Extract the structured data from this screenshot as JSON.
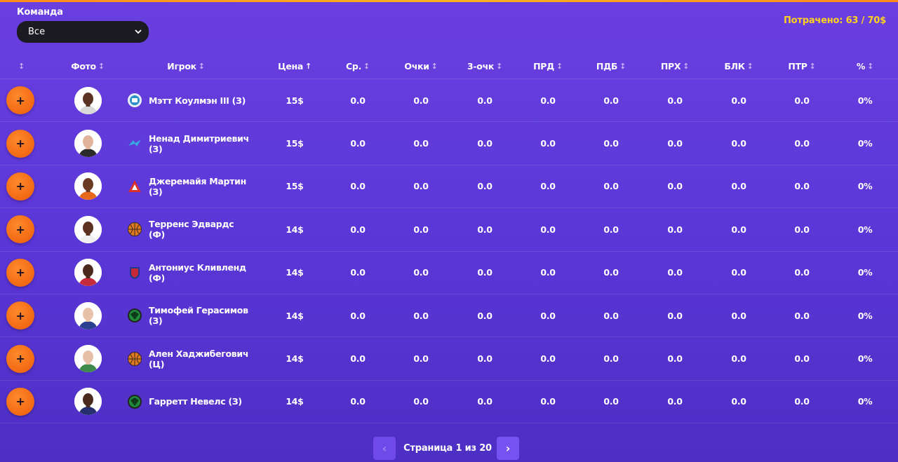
{
  "filter": {
    "label": "Команда",
    "selected": "Все"
  },
  "budget": {
    "text": "Потрачено: 63 / 70$"
  },
  "table": {
    "columns": [
      {
        "key": "add",
        "label": "",
        "sort": "↕"
      },
      {
        "key": "photo",
        "label": "Фото",
        "sort": "↕"
      },
      {
        "key": "player",
        "label": "Игрок",
        "sort": "↕"
      },
      {
        "key": "price",
        "label": "Цена",
        "sort": "↑"
      },
      {
        "key": "avg",
        "label": "Ср.",
        "sort": "↕"
      },
      {
        "key": "points",
        "label": "Очки",
        "sort": "↕"
      },
      {
        "key": "three",
        "label": "3-очк",
        "sort": "↕"
      },
      {
        "key": "ast",
        "label": "ПРД",
        "sort": "↕"
      },
      {
        "key": "reb",
        "label": "ПДБ",
        "sort": "↕"
      },
      {
        "key": "stl",
        "label": "ПРХ",
        "sort": "↕"
      },
      {
        "key": "blk",
        "label": "БЛК",
        "sort": "↕"
      },
      {
        "key": "tov",
        "label": "ПТР",
        "sort": "↕"
      },
      {
        "key": "pct",
        "label": "%",
        "sort": "↕"
      }
    ],
    "rows": [
      {
        "add": "+",
        "name": "Мэтт Коулмэн III (З)",
        "price": "15$",
        "avg": "0.0",
        "points": "0.0",
        "three": "0.0",
        "ast": "0.0",
        "reb": "0.0",
        "stl": "0.0",
        "blk": "0.0",
        "tov": "0.0",
        "pct": "0%",
        "team_logo": "parma-logo-icon",
        "team_color": "#2f8ec9",
        "skin": "#5a3324",
        "jersey": "#d9d9d9"
      },
      {
        "add": "+",
        "name": "Ненад Димитриевич (З)",
        "price": "15$",
        "avg": "0.0",
        "points": "0.0",
        "three": "0.0",
        "ast": "0.0",
        "reb": "0.0",
        "stl": "0.0",
        "blk": "0.0",
        "tov": "0.0",
        "pct": "0%",
        "team_logo": "zenit-logo-icon",
        "team_color": "#39a7e0",
        "skin": "#e0b49a",
        "jersey": "#2b2b2b"
      },
      {
        "add": "+",
        "name": "Джеремайя Мартин (З)",
        "price": "15$",
        "avg": "0.0",
        "points": "0.0",
        "three": "0.0",
        "ast": "0.0",
        "reb": "0.0",
        "stl": "0.0",
        "blk": "0.0",
        "tov": "0.0",
        "pct": "0%",
        "team_logo": "lokomotiv-logo-icon",
        "team_color": "#d9322a",
        "skin": "#6b3a22",
        "jersey": "#e76a1c"
      },
      {
        "add": "+",
        "name": "Терренс Эдвардс (Ф)",
        "price": "14$",
        "avg": "0.0",
        "points": "0.0",
        "three": "0.0",
        "ast": "0.0",
        "reb": "0.0",
        "stl": "0.0",
        "blk": "0.0",
        "tov": "0.0",
        "pct": "0%",
        "team_logo": "ball-logo-icon",
        "team_color": "#e07a22",
        "skin": "#5b3220",
        "jersey": "#f0f0f0"
      },
      {
        "add": "+",
        "name": "Антониус Кливленд (Ф)",
        "price": "14$",
        "avg": "0.0",
        "points": "0.0",
        "three": "0.0",
        "ast": "0.0",
        "reb": "0.0",
        "stl": "0.0",
        "blk": "0.0",
        "tov": "0.0",
        "pct": "0%",
        "team_logo": "cska-logo-icon",
        "team_color": "#c8283a",
        "skin": "#4b2a1c",
        "jersey": "#c52b3a"
      },
      {
        "add": "+",
        "name": "Тимофей Герасимов (З)",
        "price": "14$",
        "avg": "0.0",
        "points": "0.0",
        "three": "0.0",
        "ast": "0.0",
        "reb": "0.0",
        "stl": "0.0",
        "blk": "0.0",
        "tov": "0.0",
        "pct": "0%",
        "team_logo": "unics-logo-icon",
        "team_color": "#1f8a3a",
        "skin": "#e8c2a8",
        "jersey": "#2a3f8f"
      },
      {
        "add": "+",
        "name": "Ален Хаджибегович (Ц)",
        "price": "14$",
        "avg": "0.0",
        "points": "0.0",
        "three": "0.0",
        "ast": "0.0",
        "reb": "0.0",
        "stl": "0.0",
        "blk": "0.0",
        "tov": "0.0",
        "pct": "0%",
        "team_logo": "ball-logo-icon",
        "team_color": "#e07a22",
        "skin": "#e6c0a6",
        "jersey": "#3d8a4a"
      },
      {
        "add": "+",
        "name": "Гарретт Невелс (З)",
        "price": "14$",
        "avg": "0.0",
        "points": "0.0",
        "three": "0.0",
        "ast": "0.0",
        "reb": "0.0",
        "stl": "0.0",
        "blk": "0.0",
        "tov": "0.0",
        "pct": "0%",
        "team_logo": "unics-logo-icon",
        "team_color": "#1f8a3a",
        "skin": "#4a2a1c",
        "jersey": "#26306e"
      }
    ]
  },
  "pagination": {
    "prev": "‹",
    "text": "Страница 1 из 20",
    "next": "›"
  }
}
